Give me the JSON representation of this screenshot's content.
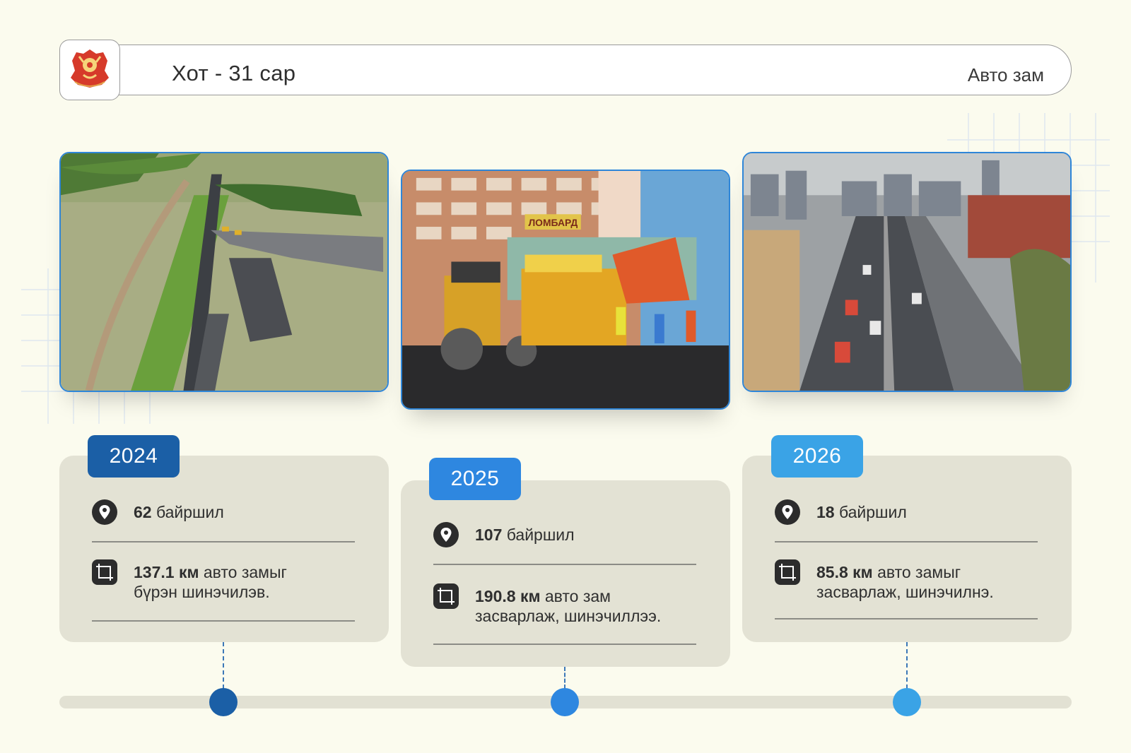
{
  "header": {
    "title": "Хот - 31 сар",
    "category": "Авто зам",
    "logo_icon": "city-emblem-icon"
  },
  "colors": {
    "background": "#fbfbee",
    "card": "#e3e2d4",
    "photo_border": "#2f86d8",
    "year_2024": "#1b5fa6",
    "year_2025": "#2e87e0",
    "year_2026": "#3aa3e6"
  },
  "cards": [
    {
      "year": "2024",
      "locations_value": "62",
      "locations_label": " байршил",
      "distance_value": "137.1 км",
      "distance_text_1": " авто замыг",
      "distance_text_2": "бүрэн шинэчилэв.",
      "photo": "aerial-road-construction-photo"
    },
    {
      "year": "2025",
      "locations_value": "107",
      "locations_label": " байршил",
      "distance_value": "190.8 км",
      "distance_text_1": " авто зам",
      "distance_text_2": "засварлаж, шинэчиллээ.",
      "photo": "asphalt-paving-crew-photo",
      "sign_text": "ЛОМБАРД"
    },
    {
      "year": "2026",
      "locations_value": "18",
      "locations_label": " байршил",
      "distance_value": "85.8 км",
      "distance_text_1": " авто замыг",
      "distance_text_2": "засварлаж, шинэчилнэ.",
      "photo": "city-highway-photo"
    }
  ]
}
